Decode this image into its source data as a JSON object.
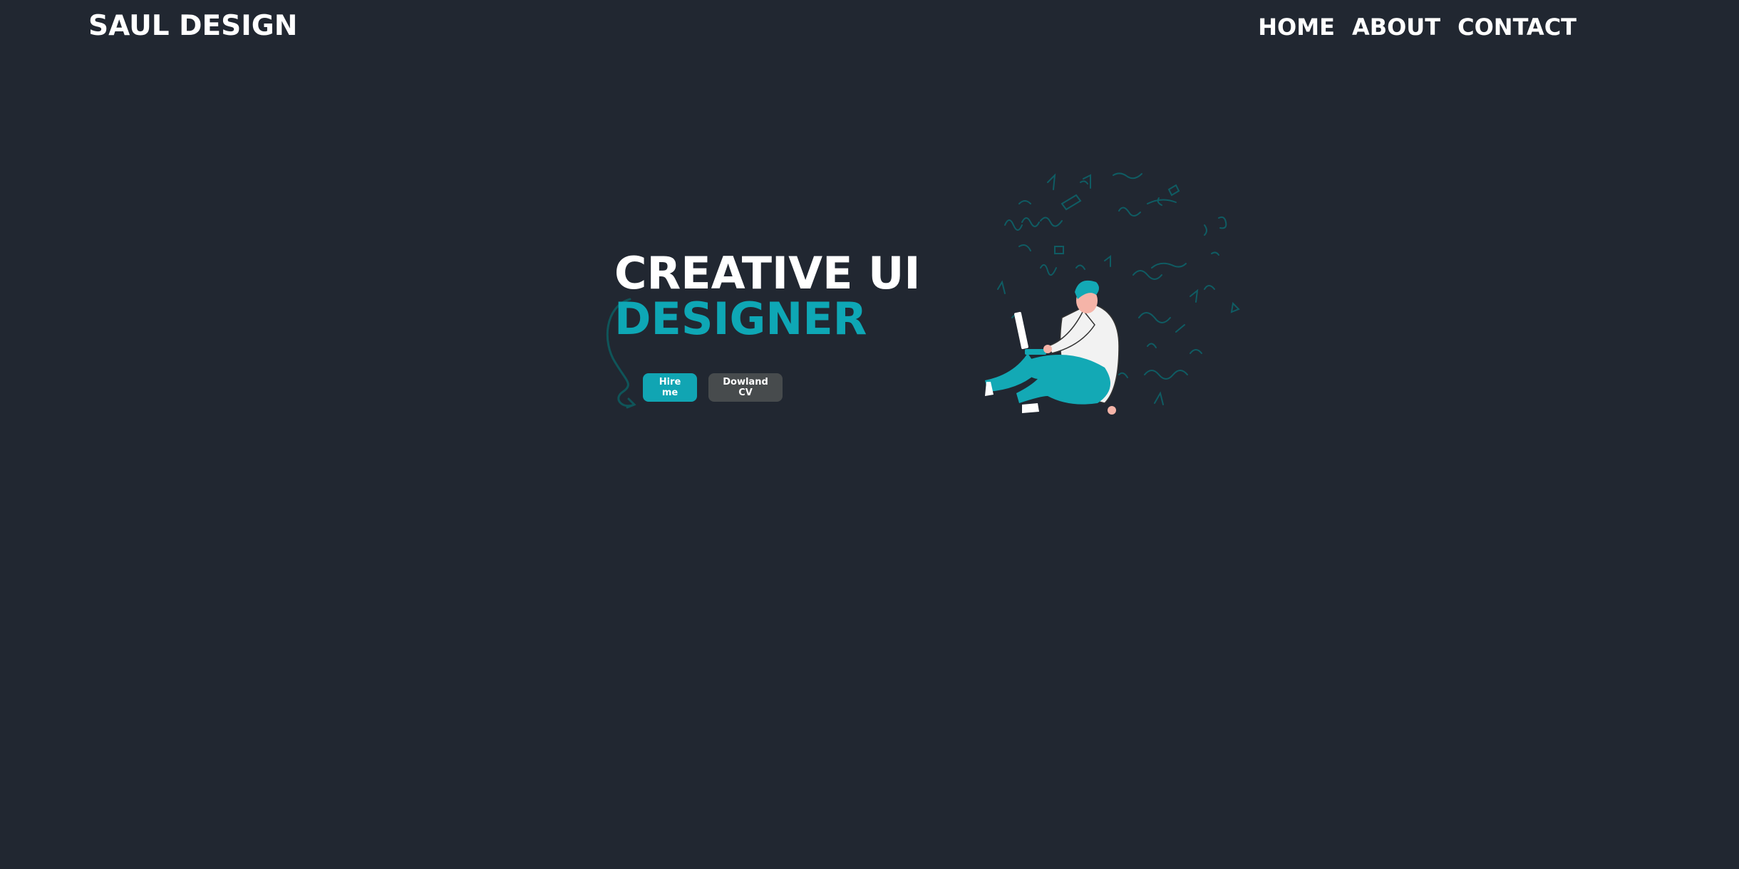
{
  "brand": {
    "name": "SAUL DESIGN"
  },
  "nav": {
    "items": [
      {
        "label": "HOME"
      },
      {
        "label": "ABOUT"
      },
      {
        "label": "CONTACT"
      }
    ]
  },
  "hero": {
    "title_line1": "CREATIVE UI",
    "title_line2": "DESIGNER",
    "buttons": {
      "hire_label": "Hire me",
      "cv_label": "Dowland CV"
    }
  },
  "colors": {
    "background": "#212731",
    "accent": "#0ea7b5",
    "text": "#ffffff",
    "secondary_button": "#474b4d"
  },
  "illustration": {
    "icon": "developer-illustration"
  }
}
